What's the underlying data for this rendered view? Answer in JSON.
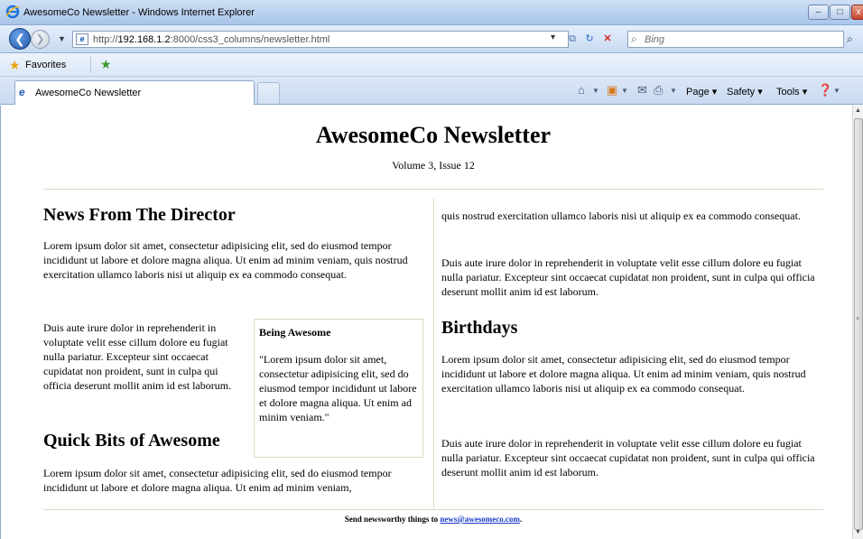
{
  "window": {
    "title": "AwesomeCo Newsletter - Windows Internet Explorer",
    "url_prefix": "http://",
    "url_host": "192.168.1.2",
    "url_path": ":8000/css3_columns/newsletter.html",
    "search_placeholder": "Bing"
  },
  "favorites": {
    "label": "Favorites"
  },
  "tab": {
    "label": "AwesomeCo Newsletter"
  },
  "commands": {
    "page": "Page ▾",
    "safety": "Safety ▾",
    "tools": "Tools ▾"
  },
  "newsletter": {
    "title": "AwesomeCo Newsletter",
    "issue": "Volume 3, Issue 12",
    "director": {
      "heading": "News From The Director",
      "p1": "Lorem ipsum dolor sit amet, consectetur adipisicing elit, sed do eiusmod tempor incididunt ut labore et dolore magna aliqua. Ut enim ad minim veniam, quis nostrud exercitation ullamco laboris nisi ut aliquip ex ea commodo consequat.",
      "p2": "Duis aute irure dolor in reprehenderit in voluptate velit esse cillum dolore eu fugiat nulla pariatur. Excepteur sint occaecat cupidatat non proident, sunt in culpa qui officia deserunt mollit anim id est laborum."
    },
    "sidebar": {
      "heading": "Being Awesome",
      "quote": "\"Lorem ipsum dolor sit amet, consectetur adipisicing elit, sed do eiusmod tempor incididunt ut labore et dolore magna aliqua. Ut enim ad minim veniam.\""
    },
    "quick_bits": {
      "heading": "Quick Bits of Awesome",
      "p1": "Lorem ipsum dolor sit amet, consectetur adipisicing elit, sed do eiusmod tempor incididunt ut labore et dolore magna aliqua. Ut enim ad minim veniam,",
      "p1_cont": "quis nostrud exercitation ullamco laboris nisi ut aliquip ex ea commodo consequat.",
      "p2": "Duis aute irure dolor in reprehenderit in voluptate velit esse cillum dolore eu fugiat nulla pariatur. Excepteur sint occaecat cupidatat non proident, sunt in culpa qui officia deserunt mollit anim id est laborum."
    },
    "birthdays": {
      "heading": "Birthdays",
      "p1": "Lorem ipsum dolor sit amet, consectetur adipisicing elit, sed do eiusmod tempor incididunt ut labore et dolore magna aliqua. Ut enim ad minim veniam, quis nostrud exercitation ullamco laboris nisi ut aliquip ex ea commodo consequat.",
      "p2": "Duis aute irure dolor in reprehenderit in voluptate velit esse cillum dolore eu fugiat nulla pariatur. Excepteur sint occaecat cupidatat non proident, sunt in culpa qui officia deserunt mollit anim id est laborum."
    },
    "footer": {
      "text_before": "Send newsworthy things to ",
      "email": "news@awesomeco.com",
      "text_after": "."
    }
  }
}
